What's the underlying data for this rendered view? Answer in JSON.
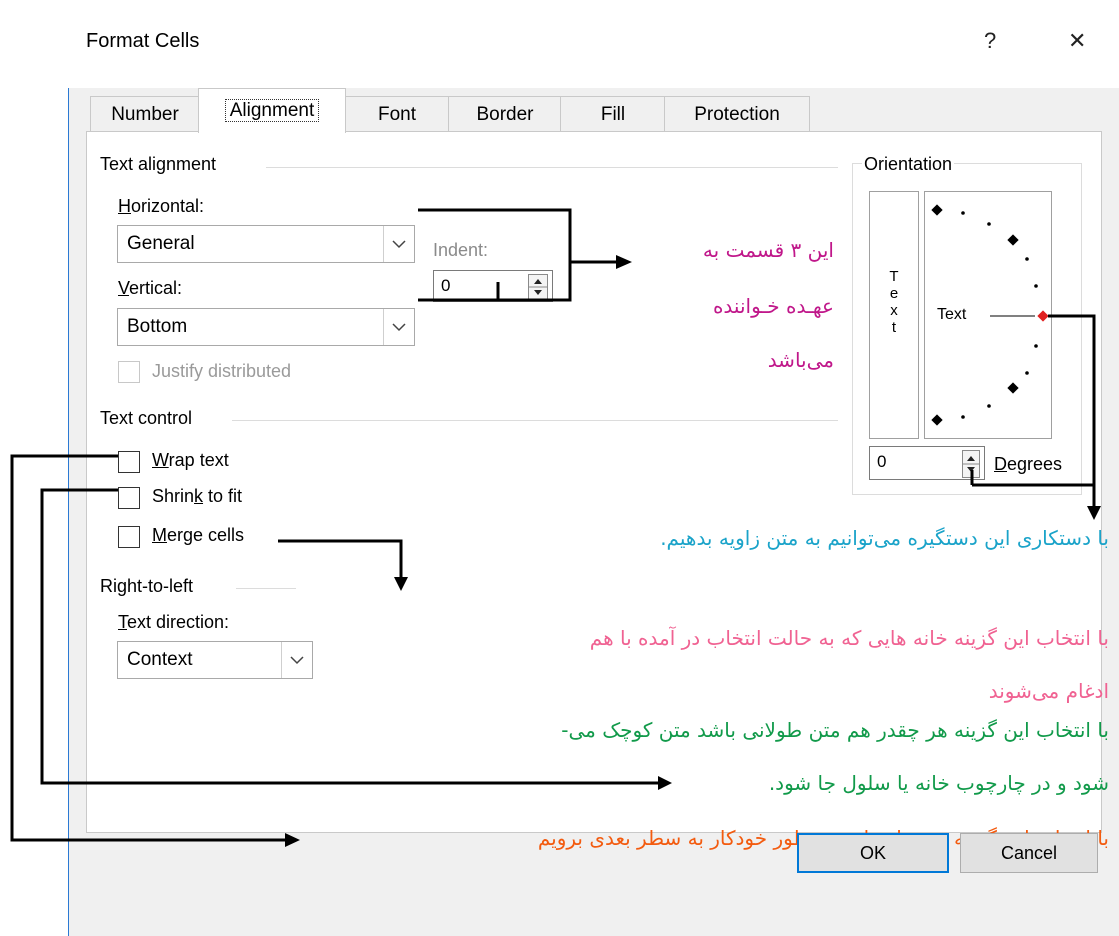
{
  "window": {
    "title": "Format Cells",
    "help": "?",
    "close": "✕"
  },
  "tabs": [
    {
      "label": "Number"
    },
    {
      "label": "Alignment"
    },
    {
      "label": "Font"
    },
    {
      "label": "Border"
    },
    {
      "label": "Fill"
    },
    {
      "label": "Protection"
    }
  ],
  "text_alignment": {
    "header": "Text alignment",
    "horizontal_label": "Horizontal:",
    "horizontal_value": "General",
    "vertical_label": "Vertical:",
    "vertical_value": "Bottom",
    "indent_label": "Indent:",
    "indent_value": "0",
    "justify_distributed": "Justify distributed"
  },
  "orientation": {
    "header": "Orientation",
    "vertical_text": [
      "T",
      "e",
      "x",
      "t"
    ],
    "dial_text": "Text",
    "degrees_value": "0",
    "degrees_label": "Degrees"
  },
  "text_control": {
    "header": "Text control",
    "wrap_text": "Wrap text",
    "shrink_to_fit": "Shrink to fit",
    "merge_cells": "Merge cells",
    "wrap_checked": false,
    "shrink_checked": false,
    "merge_checked": false
  },
  "right_to_left": {
    "header": "Right-to-left",
    "direction_label": "Text direction:",
    "direction_value": "Context"
  },
  "annotations": {
    "alignment_note": [
      "این ۳ قسمت به",
      "عهـده خـواننده",
      "می‌باشد"
    ],
    "orientation_note": "با دستکاری این دستگیره می‌توانیم به متن زاویه بدهیم.",
    "merge_note": [
      "با انتخاب این گزینه خانه هایی که به حالت انتخاب در آمده با هم",
      "ادغام می‌شوند"
    ],
    "shrink_note": [
      "با انتخاب این گزینه هر چقدر هم متن طولانی باشد متن کوچک می-",
      "شود و در چارچوب خانه یا سلول جا شود."
    ],
    "wrap_note": "با انتخاب این گزینه در زمان تایپ به طور خودکار به سطر بعدی برویم"
  },
  "colors": {
    "magenta": "#c0178a",
    "cyan": "#1aa3c9",
    "pink": "#f06292",
    "green": "#119a4a",
    "orange": "#f35b0f",
    "accent": "#0078d7"
  },
  "buttons": {
    "ok": "OK",
    "cancel": "Cancel"
  }
}
